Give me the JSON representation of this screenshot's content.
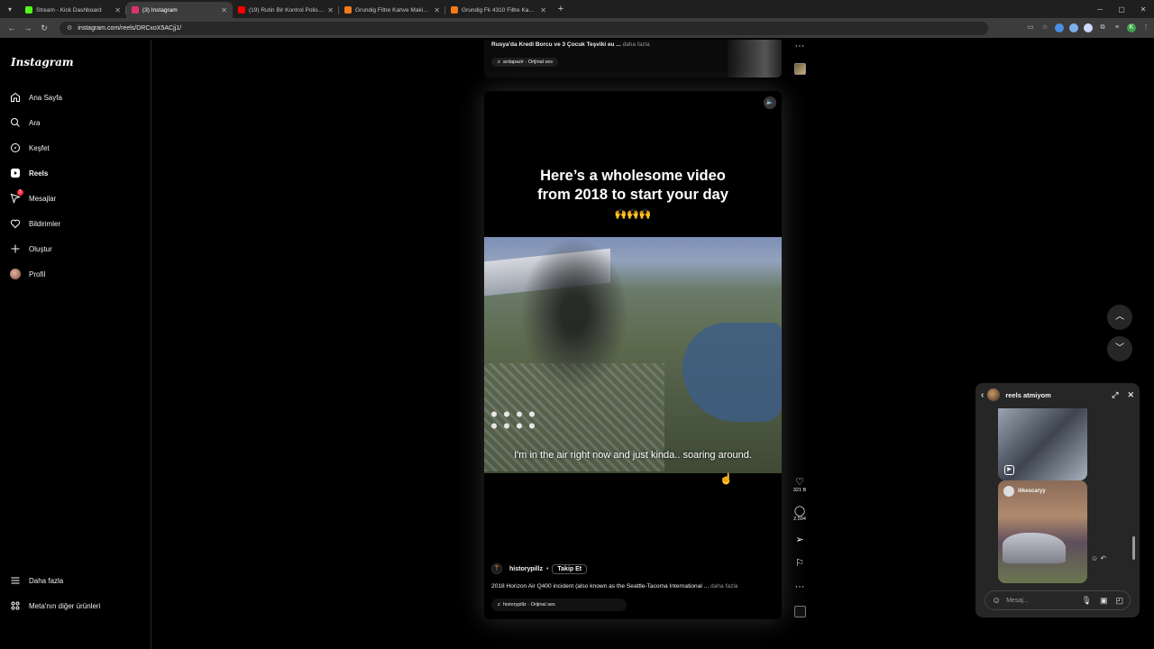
{
  "browser": {
    "tabs": [
      {
        "title": "Stream - Kick Dashboard",
        "fav_color": "#53fc18",
        "active": false
      },
      {
        "title": "(3) Instagram",
        "fav_color": "#e1306c",
        "active": true
      },
      {
        "title": "(19) Rutin Bir Kontrol Polislerin",
        "fav_color": "#ff0000",
        "active": false
      },
      {
        "title": "Grundig Filtre Kahve Makinesi",
        "fav_color": "#f27a1a",
        "active": false
      },
      {
        "title": "Grundig Fk 4310 Filtre Kahve M",
        "fav_color": "#f27a1a",
        "active": false
      }
    ],
    "url": "instagram.com/reels/DRCxoX5ACjj1/"
  },
  "sidebar": {
    "logo": "Instagram",
    "items": [
      {
        "label": "Ana Sayfa",
        "icon": "home-icon"
      },
      {
        "label": "Ara",
        "icon": "search-icon"
      },
      {
        "label": "Keşfet",
        "icon": "compass-icon"
      },
      {
        "label": "Reels",
        "icon": "reels-icon"
      },
      {
        "label": "Mesajlar",
        "icon": "messages-icon",
        "badge": "1"
      },
      {
        "label": "Bildirimler",
        "icon": "heart-icon"
      },
      {
        "label": "Oluştur",
        "icon": "plus-icon"
      },
      {
        "label": "Profil",
        "icon": "avatar"
      }
    ],
    "more": "Daha fazla",
    "meta": "Meta'nın diğer ürünleri"
  },
  "prev_reel": {
    "caption": "Rusya'da Kredi Borcu ve 3 Çocuk Teşviki eu ...",
    "caption_more": "daha fazla",
    "audio": "ardapazir · Orijinal ses"
  },
  "reel": {
    "headline_line1": "Here’s a wholesome video",
    "headline_line2": "from 2018 to start your day",
    "emoji": "🙌🙌🙌",
    "subtitle": "I'm in the air right now and just kinda.. soaring around.",
    "author": "historypillz",
    "follow": "Takip Et",
    "description": "2018 Horizon Air Q400 incident (also known as the Seattle-Tacoma International ...",
    "description_more": "daha fazla",
    "audio": "historypillz · Orijinal ses",
    "likes": "321 B",
    "comments": "2.594"
  },
  "chat": {
    "title": "reels atmiyom",
    "shared_user": "ilikescaryy",
    "placeholder": "Mesaj..."
  }
}
